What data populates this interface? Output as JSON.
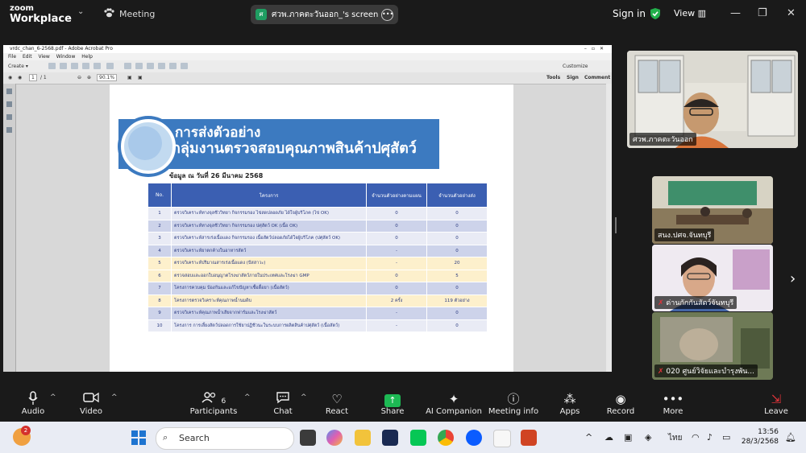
{
  "topbar": {
    "logo_line1": "zoom",
    "logo_line2": "Workplace",
    "meeting_label": "Meeting",
    "share_avatar": "ศ",
    "share_label": "ศวพ.ภาคตะวันออก_'s screen",
    "signin_label": "Sign in",
    "view_label": "View"
  },
  "acrobat": {
    "title": "vrdc_chan_6-2568.pdf - Adobe Acrobat Pro",
    "menu": [
      "File",
      "Edit",
      "View",
      "Window",
      "Help"
    ],
    "create_label": "Create",
    "customize_label": "Customize",
    "page_current": "1",
    "page_total": "/ 1",
    "zoom": "90.1%",
    "tools_label": "Tools",
    "sign_label": "Sign",
    "comment_label": "Comment"
  },
  "document": {
    "title_line1": "การส่งตัวอย่าง",
    "title_line2": "กลุ่มงานตรวจสอบคุณภาพสินค้าปศุสัตว์",
    "date_line": "ข้อมูล ณ วันที่ 26 มีนาคม 2568",
    "table_headers": [
      "No.",
      "โครงการ",
      "จำนวนตัวอย่างตามแผน",
      "จำนวนตัวอย่างส่ง"
    ],
    "rows": [
      {
        "no": "1",
        "project": "ตรวจวิเคราะห์ทางจุลชีววิทยา กิจกรรมรอง ไข่สดปลอดภัย ได้ใจผู้บริโภค (ไข่ OK)",
        "plan": "0",
        "sent": "0",
        "style": "light"
      },
      {
        "no": "2",
        "project": "ตรวจวิเคราะห์ทางจุลชีววิทยา กิจกรรมรอง ปศุสัตว์ OK (เนื้อ OK)",
        "plan": "0",
        "sent": "0",
        "style": "blue"
      },
      {
        "no": "3",
        "project": "ตรวจวิเคราะห์สารเร่งเนื้อแดง กิจกรรมรอง เนื้อสัตว์ปลอดภัยได้ใจผู้บริโภค (ปศุสัตว์ OK)",
        "plan": "0",
        "sent": "0",
        "style": "light"
      },
      {
        "no": "4",
        "project": "ตรวจวิเคราะห์ยาตกค้างในอาหารสัตว์",
        "plan": "-",
        "sent": "0",
        "style": "blue"
      },
      {
        "no": "5",
        "project": "ตรวจวิเคราะห์ปริมาณสารเร่งเนื้อแดง (ปัสสาวะ)",
        "plan": "-",
        "sent": "20",
        "style": "yellow"
      },
      {
        "no": "6",
        "project": "ตรวจสอบและออกใบอนุญาตโรงฆ่าสัตว์ภายในประเทศและโรงฆ่า GMP",
        "plan": "0",
        "sent": "5",
        "style": "yellow"
      },
      {
        "no": "7",
        "project": "โครงการควบคุม ป้องกันและแก้ไขปัญหาเชื้อดื้อยา (เนื้อสัตว์)",
        "plan": "0",
        "sent": "0",
        "style": "blue"
      },
      {
        "no": "8",
        "project": "โครงการตรวจวิเคราะห์คุณภาพน้ำนมดิบ",
        "plan": "2 ครั้ง",
        "sent": "119 ตัวอย่าง",
        "style": "yellow"
      },
      {
        "no": "9",
        "project": "ตรวจวิเคราะห์คุณภาพน้ำเสียจากฟาร์มและโรงฆ่าสัตว์",
        "plan": "-",
        "sent": "0",
        "style": "blue"
      },
      {
        "no": "10",
        "project": "โครงการ การเลี้ยงสัตว์ปลอดการใช้ยาปฏิชีวนะในระบบการผลิตสินค้าปศุสัตว์ (เนื้อสัตว์)",
        "plan": "-",
        "sent": "0",
        "style": "light"
      }
    ]
  },
  "participants": {
    "main_name": "ศวพ.ภาคตะวันออก",
    "tile1_name": "สนง.ปศจ.จันทบุรี",
    "tile2_name": "ด่านกักกันสัตว์จันทบุรี",
    "tile3_name": "020 ศูนย์วิจัยและบำรุงพัน..."
  },
  "toolbar": {
    "audio": "Audio",
    "video": "Video",
    "participants": "Participants",
    "participants_count": "6",
    "chat": "Chat",
    "react": "React",
    "share": "Share",
    "ai_companion": "AI Companion",
    "meeting_info": "Meeting info",
    "apps": "Apps",
    "record": "Record",
    "more": "More",
    "leave": "Leave"
  },
  "taskbar": {
    "search_placeholder": "Search",
    "notification_badge": "2",
    "language": "ไทย",
    "time": "13:56",
    "date": "28/3/2568"
  },
  "colors": {
    "banner_blue": "#3c7ac0",
    "table_header": "#3b5fb2",
    "share_green": "#1db954",
    "leave_red": "#e0343a"
  }
}
